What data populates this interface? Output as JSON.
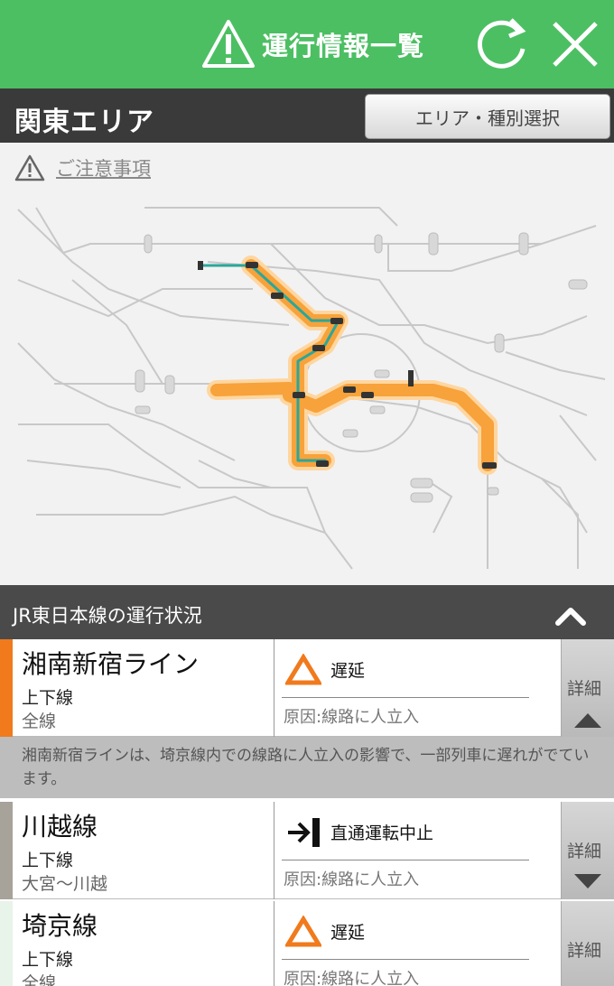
{
  "header": {
    "title": "運行情報一覧",
    "refresh_icon": "refresh-icon",
    "close_icon": "close-icon",
    "color": "#4cbf63"
  },
  "area": {
    "title": "関東エリア",
    "select_label": "エリア・種別選択"
  },
  "notice": {
    "label": "ご注意事項"
  },
  "section": {
    "title": "JR東日本線の運行状況"
  },
  "lines": [
    {
      "name": "湘南新宿ライン",
      "direction": "上下線",
      "section": "全線",
      "status": "遅延",
      "status_icon": "delay-triangle-icon",
      "cause": "原因:線路に人立入",
      "detail": "詳細",
      "stripe_color": "#f07a1c",
      "expanded": true
    },
    {
      "name": "川越線",
      "direction": "上下線",
      "section": "大宮〜川越",
      "status": "直通運転中止",
      "status_icon": "through-service-stop-icon",
      "cause": "原因:線路に人立入",
      "detail": "詳細",
      "stripe_color": "#a7a29a",
      "expanded": false
    },
    {
      "name": "埼京線",
      "direction": "上下線",
      "section": "全線",
      "status": "遅延",
      "status_icon": "delay-triangle-icon",
      "cause": "原因:線路に人立入",
      "detail": "詳細",
      "stripe_color": "#ffffff",
      "expanded": false
    }
  ],
  "description": "湘南新宿ラインは、埼京線内での線路に人立入の影響で、一部列車に遅れがでています。"
}
